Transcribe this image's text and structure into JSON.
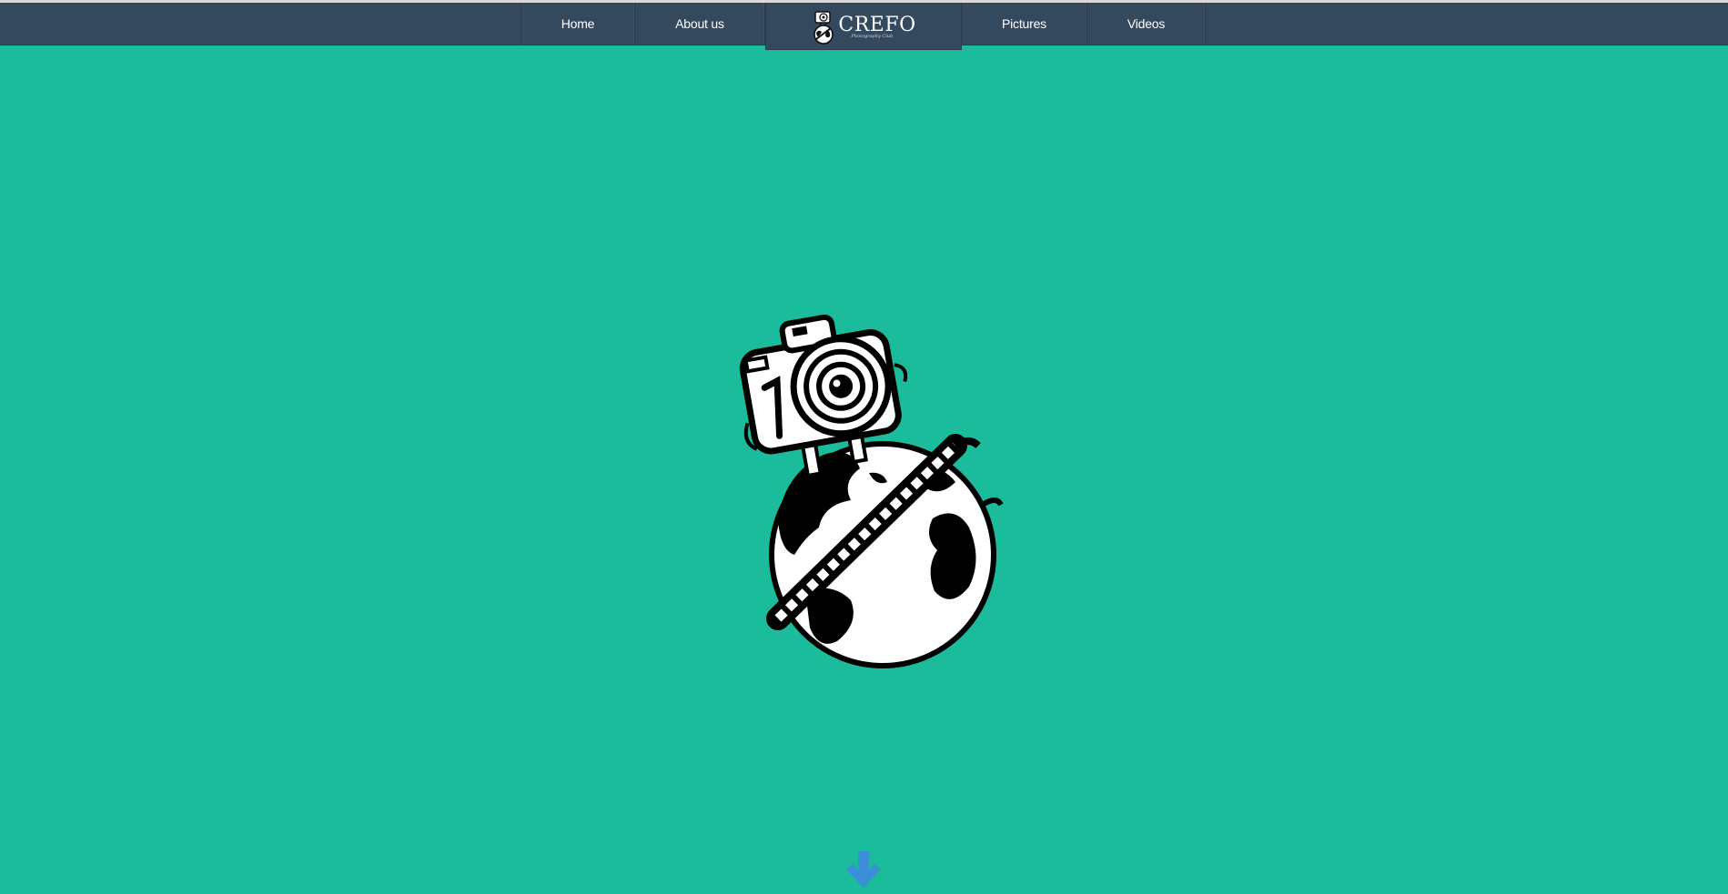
{
  "colors": {
    "background": "#1bbc9b",
    "navbar": "#34495e",
    "arrow": "#3a8fd6"
  },
  "nav": {
    "items": [
      {
        "label": "Home"
      },
      {
        "label": "About us"
      },
      {
        "label": "Pictures"
      },
      {
        "label": "Videos"
      }
    ],
    "logo": {
      "name": "CREFO",
      "subtitle": "Photography Club"
    }
  },
  "hero": {
    "icon": "camera-on-globe-logo"
  },
  "scroll": {
    "icon": "arrow-down-icon"
  }
}
